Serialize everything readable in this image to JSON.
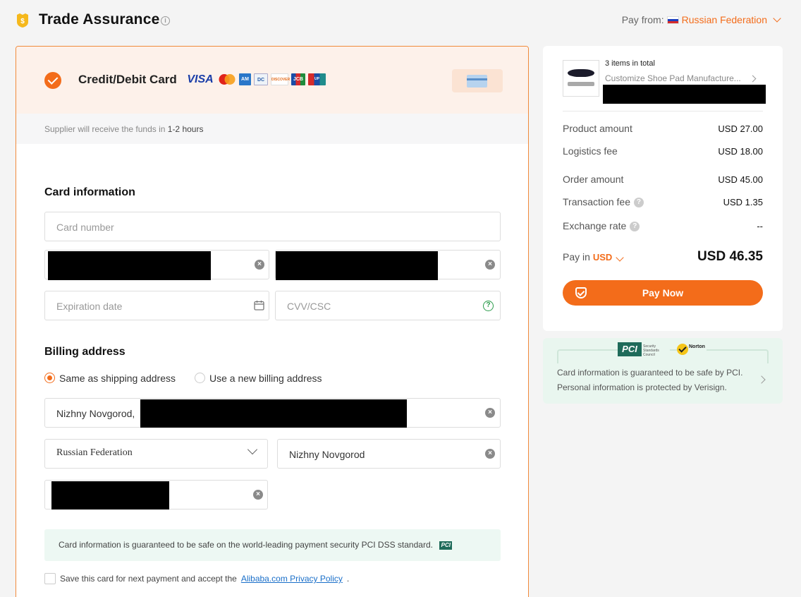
{
  "header": {
    "title": "Trade Assurance",
    "pay_from_label": "Pay from:",
    "pay_from_country": "Russian Federation"
  },
  "payment_method": {
    "label": "Credit/Debit Card",
    "brands": [
      "VISA",
      "Mastercard",
      "AMEX",
      "Diners Club",
      "DISCOVER",
      "JCB",
      "UnionPay"
    ],
    "funds_prefix": "Supplier will receive the funds in",
    "funds_time": "1-2 hours"
  },
  "card_info": {
    "title": "Card information",
    "card_number_placeholder": "Card number",
    "expiration_placeholder": "Expiration date",
    "cvv_placeholder": "CVV/CSC"
  },
  "billing": {
    "title": "Billing address",
    "option_same": "Same as shipping address",
    "option_new": "Use a new billing address",
    "address_value": "Nizhny Novgorod,",
    "country_value": "Russian Federation",
    "city_value": "Nizhny Novgorod"
  },
  "pci_note": "Card information is guaranteed to be safe on the world-leading payment security PCI DSS standard.",
  "save_card": {
    "text": "Save this card for next payment and accept the",
    "link": "Alibaba.com Privacy Policy",
    "suffix": "."
  },
  "summary": {
    "items_total": "3 items in total",
    "product_name": "Customize Shoe Pad Manufacture...",
    "rows": [
      {
        "label": "Product amount",
        "value": "USD 27.00"
      },
      {
        "label": "Logistics fee",
        "value": "USD 18.00"
      },
      {
        "label": "Order amount",
        "value": "USD 45.00"
      },
      {
        "label": "Transaction fee",
        "value": "USD 1.35"
      },
      {
        "label": "Exchange rate",
        "value": "--"
      }
    ],
    "pay_in_label": "Pay in",
    "pay_in_currency": "USD",
    "total": "USD 46.35",
    "pay_button": "Pay Now"
  },
  "security_box": {
    "line1": "Card information is guaranteed to be safe by PCI.",
    "line2": "Personal information is protected by Verisign.",
    "pci_logo": "PCI",
    "pci_small": "Security Standards Council",
    "norton_label": "Norton"
  },
  "colors": {
    "accent": "#f36c1a",
    "link": "#1a6fc9",
    "safe_bg": "#edf8f3"
  }
}
